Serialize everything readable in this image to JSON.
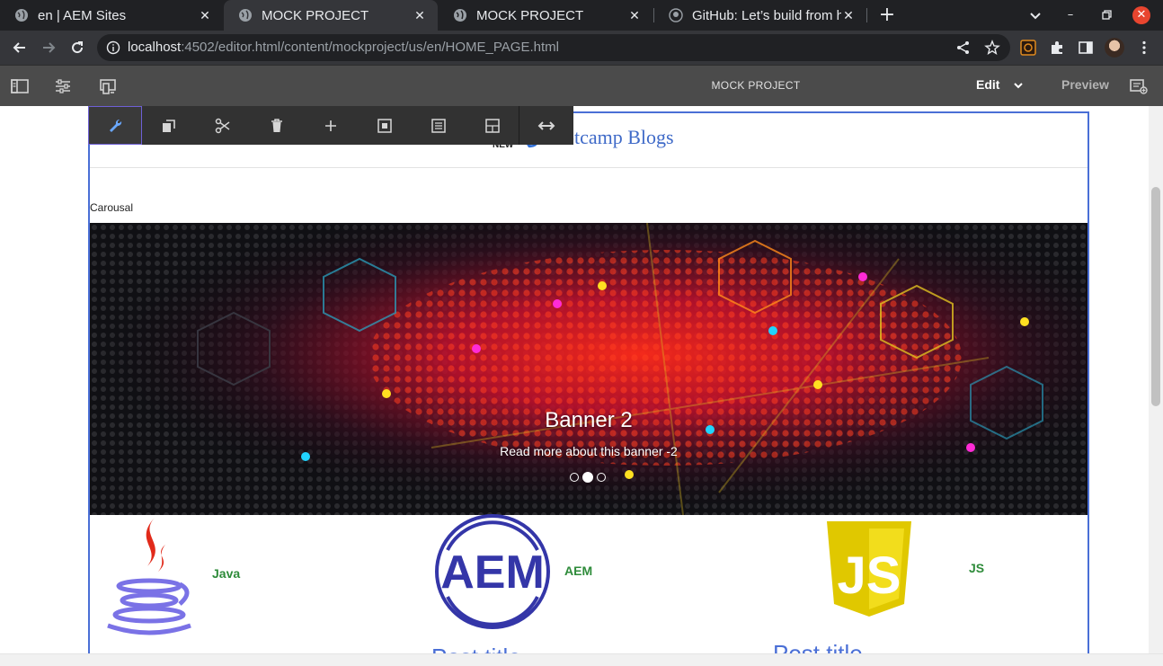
{
  "browser": {
    "tabs": [
      {
        "title": "en | AEM Sites"
      },
      {
        "title": "MOCK PROJECT"
      },
      {
        "title": "MOCK PROJECT"
      },
      {
        "title": "GitHub: Let’s build from h"
      }
    ],
    "url_host": "localhost",
    "url_path": ":4502/editor.html/content/mockproject/us/en/HOME_PAGE.html"
  },
  "aem": {
    "page_title": "MOCK PROJECT",
    "mode_label": "Edit",
    "preview_label": "Preview"
  },
  "page": {
    "blog_title": "otcamp Blogs",
    "logo_text": "NEW",
    "carousel_label": "Carousal",
    "banner": {
      "title": "Banner 2",
      "subtitle": "Read more about this banner -2",
      "slide_count": 3,
      "active_slide": 2
    },
    "techs": [
      {
        "label": "Java"
      },
      {
        "label": "AEM"
      },
      {
        "label": "JS"
      }
    ],
    "aem_logo_text": "AEM",
    "js_logo_text": "JS",
    "post_titles": [
      "Post title",
      "Post title"
    ]
  },
  "colors": {
    "accent_blue": "#4a6fd6",
    "link_green": "#2e8b3a",
    "toolbar_dark": "#323232",
    "aem_header": "#4b4b4b"
  }
}
